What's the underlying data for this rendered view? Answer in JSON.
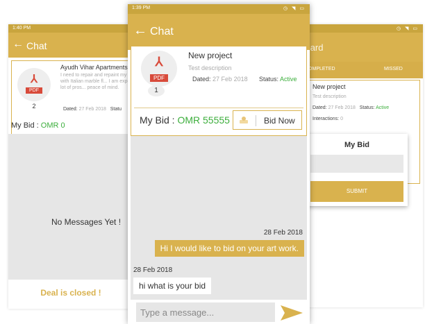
{
  "left_screen": {
    "status_time": "1:40 PM",
    "back_icon": "arrow-left-icon",
    "title": "Chat",
    "project": {
      "title": "Ayudh Vihar Apartments",
      "description": "I need to repair and repaint my house with Italian marble fl... I am expecting a lot of pros... peace of mind.",
      "pdf_label": "PDF",
      "count": "2",
      "dated_label": "Dated:",
      "dated_value": "27 Feb 2018",
      "status_label": "Statu"
    },
    "my_bid_label": "My Bid :",
    "my_bid_value": "OMR 0",
    "empty_message": "No Messages Yet !",
    "closed_message": "Deal is closed !"
  },
  "center_screen": {
    "status_time": "1:39 PM",
    "back_icon": "arrow-left-icon",
    "title": "Chat",
    "project": {
      "title": "New project",
      "description": "Test description",
      "pdf_label": "PDF",
      "count": "1",
      "dated_label": "Dated:",
      "dated_value": "27 Feb 2018",
      "status_label": "Status:",
      "status_value": "Active"
    },
    "my_bid_label": "My Bid :",
    "my_bid_value": "OMR 55555",
    "bid_button_icon": "hand-money-icon",
    "bid_button_label": "Bid Now",
    "messages": [
      {
        "timestamp": "28 Feb 2018",
        "text": "Hi I would like to bid on your art work.",
        "side": "sent"
      },
      {
        "timestamp": "28 Feb 2018",
        "text": "hi what is your bid",
        "side": "received"
      }
    ],
    "composer_placeholder": "Type a message...",
    "send_icon": "send-arrow-icon"
  },
  "right_screen": {
    "title": "nboard",
    "tabs": [
      "COMPLETED",
      "MISSED"
    ],
    "project": {
      "title": "New project",
      "description": "Test description",
      "dated_label": "Dated:",
      "dated_value": "27 Feb 2018",
      "status_label": "Status:",
      "status_value": "Active",
      "interactions_label": "Interactions:",
      "interactions_value": "0"
    },
    "dialog": {
      "title": "My Bid",
      "submit_label": "SUBMIT"
    }
  },
  "colors": {
    "accent": "#d9b24e",
    "active_green": "#3cae3c",
    "pdf_red": "#d84a3a"
  }
}
